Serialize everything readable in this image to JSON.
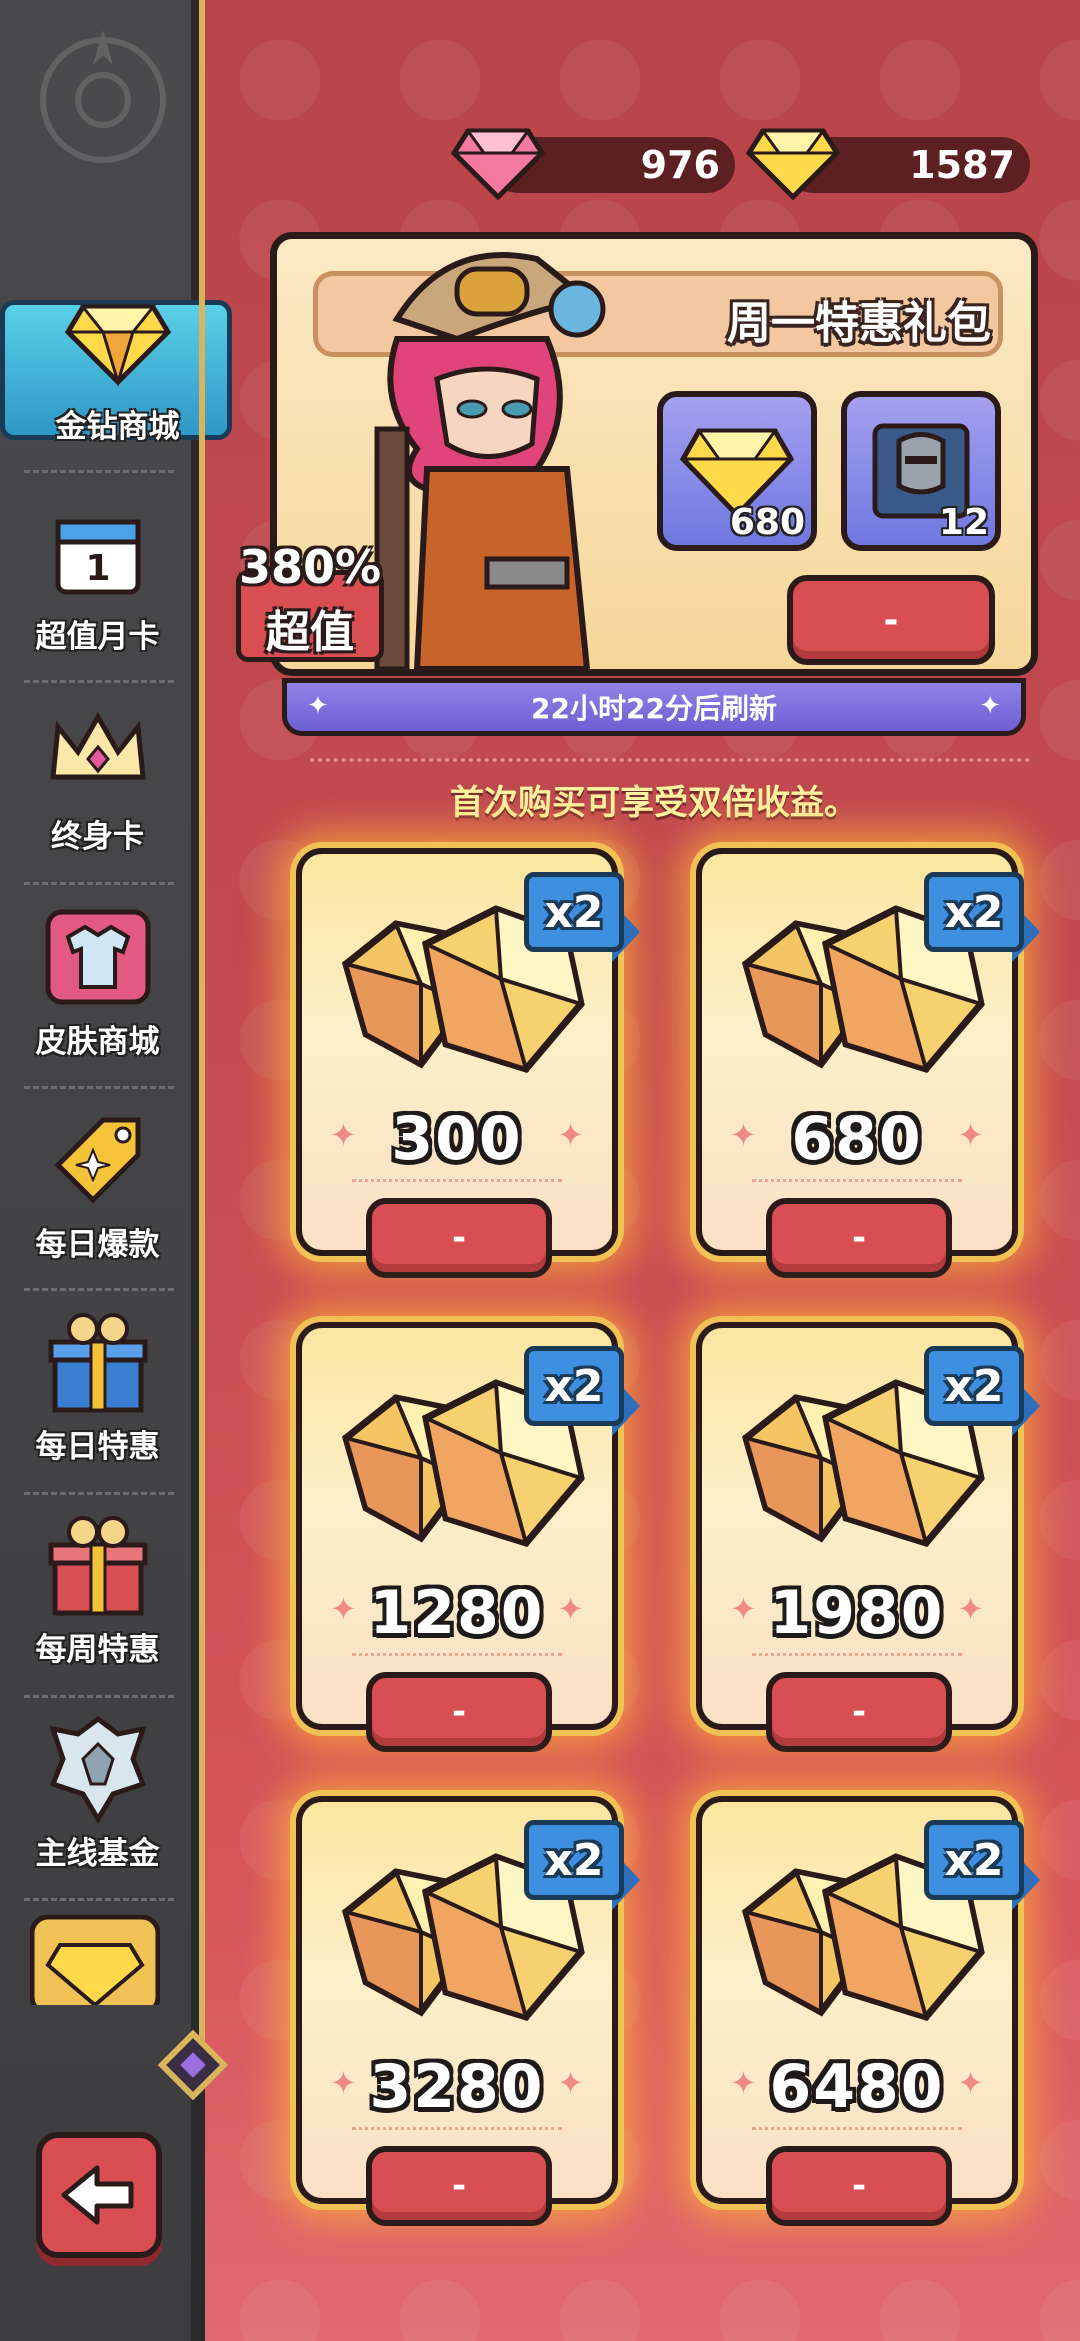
{
  "currency": {
    "pink_gems": "976",
    "gold_gems": "1587"
  },
  "sidebar": {
    "items": [
      {
        "label": "金钻商城",
        "icon": "gold-gem-icon",
        "active": true
      },
      {
        "label": "超值月卡",
        "icon": "calendar-icon",
        "active": false
      },
      {
        "label": "终身卡",
        "icon": "crown-icon",
        "active": false
      },
      {
        "label": "皮肤商城",
        "icon": "shirt-icon",
        "active": false
      },
      {
        "label": "每日爆款",
        "icon": "tag-icon",
        "active": false
      },
      {
        "label": "每日特惠",
        "icon": "blue-gift-icon",
        "active": false
      },
      {
        "label": "每周特惠",
        "icon": "red-gift-icon",
        "active": false
      },
      {
        "label": "主线基金",
        "icon": "wolf-emblem-icon",
        "active": false
      }
    ],
    "back_icon": "back-arrow-icon"
  },
  "weekly_pack": {
    "title": "周一特惠礼包",
    "badge_percent": "380%",
    "badge_label": "超值",
    "rewards": [
      {
        "icon": "gold-gem-icon",
        "count": "680"
      },
      {
        "icon": "knight-helmet-book-icon",
        "count": "12"
      }
    ],
    "buy_label": "-",
    "refresh_text": "22小时22分后刷新"
  },
  "bonus_note": "首次购买可享受双倍收益。",
  "gem_packs": [
    {
      "amount": "300",
      "badge": "x2",
      "buy_label": "-"
    },
    {
      "amount": "680",
      "badge": "x2",
      "buy_label": "-"
    },
    {
      "amount": "1280",
      "badge": "x2",
      "buy_label": "-"
    },
    {
      "amount": "1980",
      "badge": "x2",
      "buy_label": "-"
    },
    {
      "amount": "3280",
      "badge": "x2",
      "buy_label": "-"
    },
    {
      "amount": "6480",
      "badge": "x2",
      "buy_label": "-"
    }
  ],
  "colors": {
    "background": "#c24a50",
    "sidebar": "#404042",
    "button_red": "#d84e53",
    "badge_blue": "#3e8fe0",
    "refresh_purple": "#7a6ddc",
    "card_gold": "#f0c255"
  }
}
